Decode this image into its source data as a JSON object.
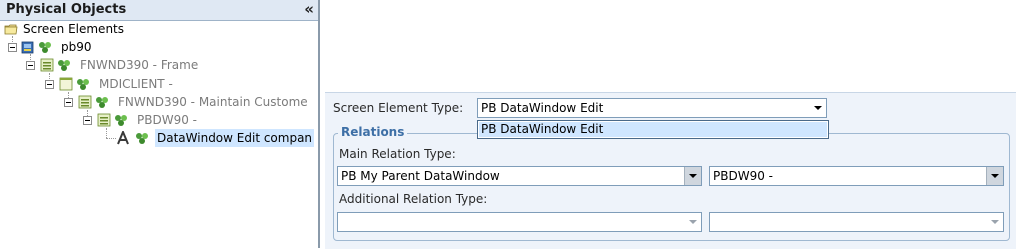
{
  "left_panel": {
    "title": "Physical Objects",
    "collapse_glyph": "«",
    "tree": {
      "root_label": "Screen Elements",
      "items": [
        {
          "label": "pb90"
        },
        {
          "label": "FNWND390 - Frame"
        },
        {
          "label": "MDICLIENT -"
        },
        {
          "label": "FNWND390 - Maintain Custome"
        },
        {
          "label": "PBDW90 -"
        },
        {
          "label": "DataWindow Edit compan"
        }
      ]
    }
  },
  "form": {
    "screen_element_type": {
      "label": "Screen Element Type:",
      "value": "PB DataWindow Edit",
      "dropdown_option": "PB DataWindow Edit"
    },
    "relations": {
      "legend": "Relations",
      "main_relation_label": "Main Relation Type:",
      "main_relation_value": "PB My Parent DataWindow",
      "main_relation_target": "PBDW90 -",
      "additional_relation_label": "Additional Relation Type:",
      "additional_relation_value": "",
      "additional_relation_target": ""
    }
  },
  "icons": {
    "folder": "folder-icon",
    "app": "application-icon",
    "window": "window-icon",
    "group": "object-group-icon",
    "text": "text-element-icon"
  },
  "colors": {
    "selection": "#cfe6ff",
    "header_bg": "#dfe8f3",
    "legend_text": "#3d6fa6"
  }
}
